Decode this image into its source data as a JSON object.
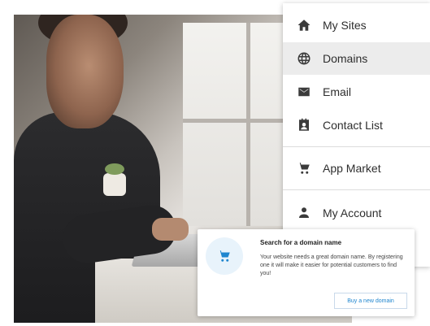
{
  "menu": {
    "items": [
      {
        "label": "My Sites",
        "icon": "home-icon",
        "active": false
      },
      {
        "label": "Domains",
        "icon": "globe-icon",
        "active": true
      },
      {
        "label": "Email",
        "icon": "mail-icon",
        "active": false
      },
      {
        "label": "Contact List",
        "icon": "contact-card-icon",
        "active": false
      },
      {
        "label": "App Market",
        "icon": "cart-icon",
        "active": false
      },
      {
        "label": "My Account",
        "icon": "person-icon",
        "active": false
      }
    ]
  },
  "card": {
    "icon": "cart-icon",
    "title": "Search for a domain name",
    "description": "Your website needs a great domain name. By registering one it will make it easier for potential customers to find you!",
    "button_label": "Buy a new domain"
  },
  "colors": {
    "accent": "#1f86cf",
    "active_bg": "#ececec",
    "icon_circle_bg": "#e8f3fb"
  }
}
